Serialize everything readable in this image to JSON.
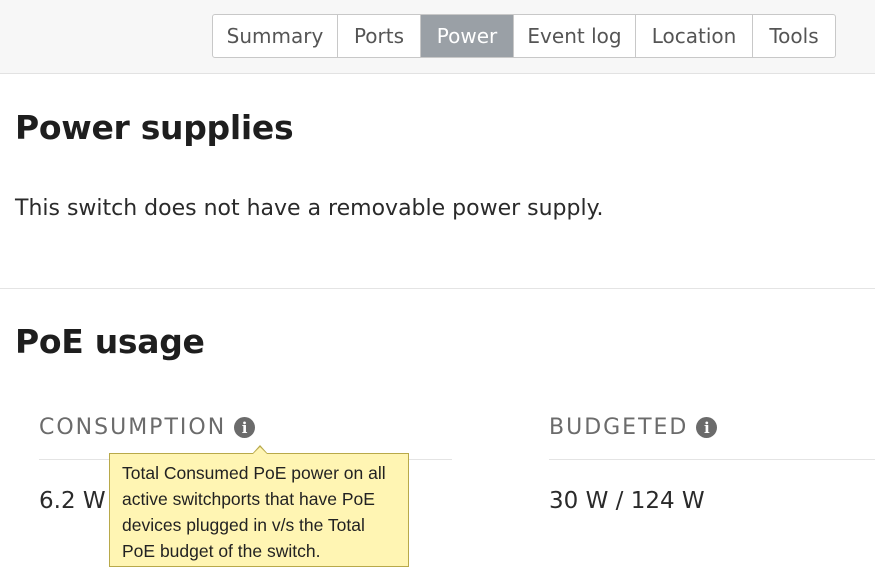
{
  "tabs": {
    "summary": "Summary",
    "ports": "Ports",
    "power": "Power",
    "event_log": "Event log",
    "location": "Location",
    "tools": "Tools",
    "active": "Power"
  },
  "power_supplies": {
    "title": "Power supplies",
    "message": "This switch does not have a removable power supply."
  },
  "poe_usage": {
    "title": "PoE usage",
    "consumption": {
      "label": "CONSUMPTION",
      "value": "6.2 W",
      "tooltip": "Total Consumed PoE power on all active switchports that have PoE devices plugged in v/s the Total PoE budget of the switch."
    },
    "budgeted": {
      "label": "BUDGETED",
      "value": "30 W / 124 W"
    }
  },
  "icons": {
    "info": "i"
  },
  "colors": {
    "active_tab_bg": "#9aa0a6",
    "tooltip_bg": "#fff5b3",
    "tooltip_border": "#b8a94a"
  }
}
